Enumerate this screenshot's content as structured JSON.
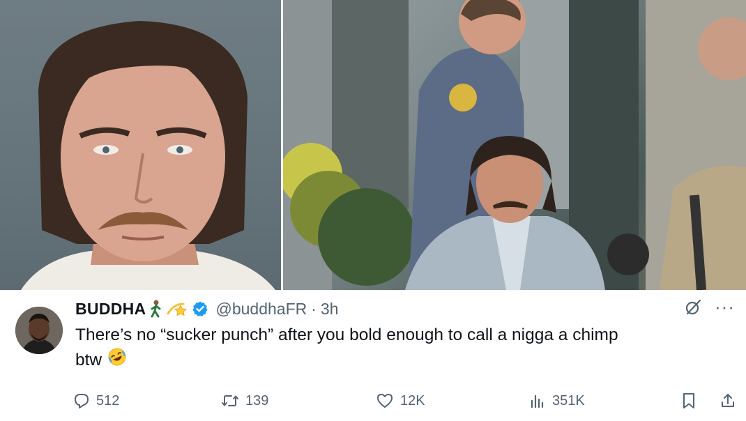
{
  "images": [
    {
      "description_icon": "mugshot-photo"
    },
    {
      "description_icon": "police-escort-photo"
    }
  ],
  "tweet": {
    "display_name": "BUDDHA",
    "name_emojis": [
      "person-walking-emoji",
      "dizzy-star-emoji"
    ],
    "verified_icon": "verified-badge-icon",
    "handle": "@buddhaFR",
    "separator": "·",
    "time": "3h",
    "text_line1": "There’s no “sucker punch” after you bold enough to call a nigga a chimp",
    "text_line2": "btw",
    "text_emoji": "rolling-laughing-emoji",
    "more_label": "···",
    "accent_color": "#1d9bf0",
    "stats": {
      "replies": "512",
      "reposts": "139",
      "likes": "12K",
      "views": "351K"
    }
  }
}
